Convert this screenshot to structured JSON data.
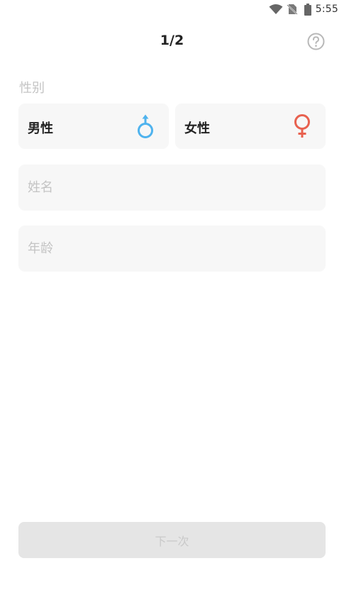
{
  "status_bar": {
    "time": "5:55",
    "icons": [
      "wifi-icon",
      "no-sim-icon",
      "battery-icon"
    ]
  },
  "header": {
    "step": "1/2",
    "help_icon": "help-circle-icon"
  },
  "gender": {
    "label": "性别",
    "options": [
      {
        "label": "男性",
        "icon": "male-symbol-icon",
        "color": "#4fb3ee"
      },
      {
        "label": "女性",
        "icon": "female-symbol-icon",
        "color": "#e8614f"
      }
    ]
  },
  "form": {
    "name": {
      "placeholder": "姓名",
      "value": ""
    },
    "age": {
      "placeholder": "年龄",
      "value": ""
    }
  },
  "actions": {
    "next_label": "下一次"
  }
}
